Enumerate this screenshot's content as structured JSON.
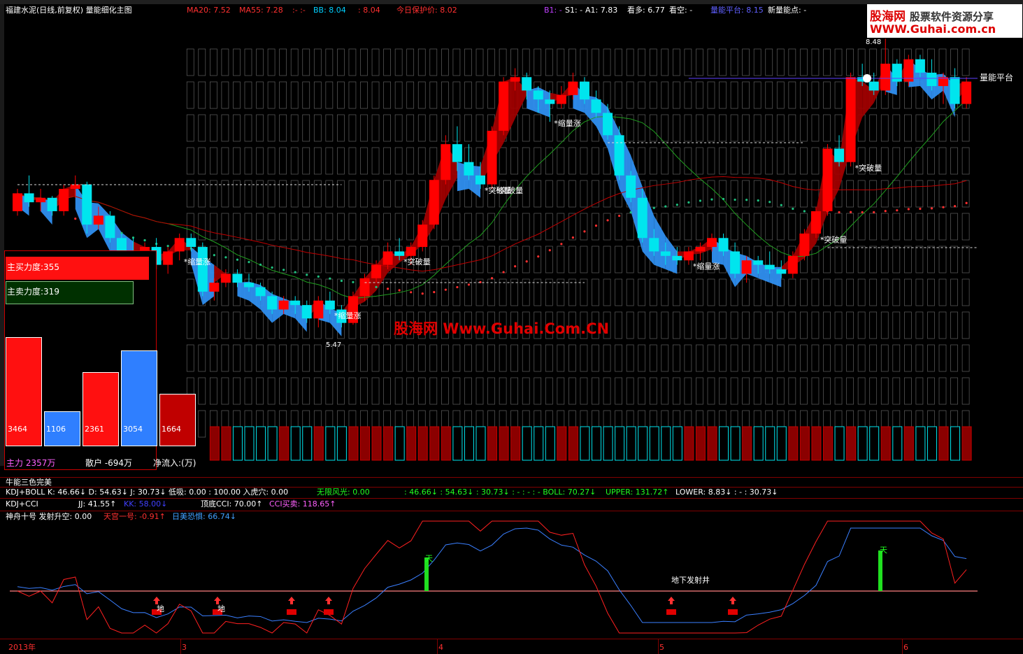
{
  "header": {
    "title": "福建水泥(日线,前复权) 量能细化主图",
    "ma20": "MA20: 7.52",
    "ma55": "MA55: 7.28",
    "dash1": ":- :-",
    "bb": "BB: 8.04",
    "bb2": ": 8.04",
    "protect": "今日保护价: 8.02",
    "b1": "B1: -",
    "s1": "S1: -",
    "a1": "A1: 7.83",
    "kanduo": "看多: 6.77",
    "kankong": "看空: -",
    "platform": "量能平台: 8.15",
    "newpoint": "新量能点: -"
  },
  "logo": {
    "line1": "股海网",
    "line1b": "股票软件资源分享",
    "line2": "WWW.Guhai.com.cn"
  },
  "watermark": "股海网 Www.Guhai.Com.CN",
  "colors": {
    "up": "#ff0000",
    "down": "#00e5ee",
    "blue_ribbon": "#2f8ff0",
    "red_ribbon": "#a00000",
    "ma_red": "#c00000",
    "ma_green": "#20a020",
    "grid": "#800000"
  },
  "chart_data": [
    {
      "type": "candlestick",
      "title": "量能细化主图",
      "price_marks": [
        "8.48",
        "5.47"
      ],
      "platform_label": "量能平台",
      "annotations": [
        {
          "text": "*缩量涨",
          "idx": 14
        },
        {
          "text": "*缩量涨",
          "idx": 27
        },
        {
          "text": "*突破量",
          "idx": 33
        },
        {
          "text": "*突破量",
          "idx": 40
        },
        {
          "text": "*突破量",
          "idx": 41
        },
        {
          "text": "*缩量涨",
          "idx": 46
        },
        {
          "text": "*缩量涨",
          "idx": 58
        },
        {
          "text": "*突破量",
          "idx": 69
        },
        {
          "text": "*突破量",
          "idx": 72
        }
      ],
      "ohlc": [
        [
          6.55,
          6.8,
          6.5,
          6.75
        ],
        [
          6.75,
          6.95,
          6.6,
          6.65
        ],
        [
          6.65,
          6.8,
          6.55,
          6.7
        ],
        [
          6.7,
          6.72,
          6.5,
          6.55
        ],
        [
          6.55,
          6.85,
          6.5,
          6.8
        ],
        [
          6.8,
          6.95,
          6.7,
          6.85
        ],
        [
          6.85,
          6.88,
          6.3,
          6.4
        ],
        [
          6.4,
          6.6,
          6.35,
          6.5
        ],
        [
          6.5,
          6.55,
          6.2,
          6.25
        ],
        [
          6.25,
          6.3,
          6.05,
          6.1
        ],
        [
          6.1,
          6.25,
          5.95,
          6.0
        ],
        [
          6.0,
          6.2,
          5.95,
          6.15
        ],
        [
          6.15,
          6.25,
          5.9,
          5.95
        ],
        [
          5.95,
          6.15,
          5.85,
          6.1
        ],
        [
          6.1,
          6.3,
          6.0,
          6.25
        ],
        [
          6.25,
          6.3,
          6.1,
          6.15
        ],
        [
          6.15,
          6.2,
          5.6,
          5.65
        ],
        [
          5.65,
          5.8,
          5.55,
          5.75
        ],
        [
          5.75,
          5.9,
          5.7,
          5.85
        ],
        [
          5.85,
          5.9,
          5.7,
          5.75
        ],
        [
          5.75,
          5.85,
          5.65,
          5.7
        ],
        [
          5.7,
          5.75,
          5.55,
          5.6
        ],
        [
          5.6,
          5.65,
          5.4,
          5.45
        ],
        [
          5.45,
          5.6,
          5.4,
          5.55
        ],
        [
          5.55,
          5.6,
          5.4,
          5.5
        ],
        [
          5.5,
          5.55,
          5.3,
          5.35
        ],
        [
          5.35,
          5.6,
          5.25,
          5.55
        ],
        [
          5.55,
          5.65,
          5.4,
          5.45
        ],
        [
          5.45,
          5.5,
          5.25,
          5.3
        ],
        [
          5.3,
          5.65,
          5.28,
          5.6
        ],
        [
          5.6,
          5.85,
          5.55,
          5.8
        ],
        [
          5.8,
          6.0,
          5.75,
          5.95
        ],
        [
          5.95,
          6.2,
          5.9,
          6.1
        ],
        [
          6.1,
          6.25,
          6.0,
          6.05
        ],
        [
          6.05,
          6.2,
          5.95,
          6.15
        ],
        [
          6.15,
          6.45,
          6.1,
          6.4
        ],
        [
          6.4,
          6.95,
          6.35,
          6.9
        ],
        [
          6.9,
          7.4,
          6.85,
          7.3
        ],
        [
          7.3,
          7.5,
          7.0,
          7.1
        ],
        [
          7.1,
          7.3,
          6.9,
          6.95
        ],
        [
          6.95,
          7.1,
          6.8,
          6.85
        ],
        [
          6.85,
          7.5,
          6.8,
          7.45
        ],
        [
          7.45,
          8.05,
          7.4,
          8.0
        ],
        [
          8.0,
          8.15,
          7.9,
          8.05
        ],
        [
          8.05,
          8.1,
          7.8,
          7.9
        ],
        [
          7.9,
          7.95,
          7.65,
          7.8
        ],
        [
          7.8,
          7.9,
          7.55,
          7.75
        ],
        [
          7.75,
          7.95,
          7.7,
          7.85
        ],
        [
          7.85,
          8.1,
          7.8,
          8.0
        ],
        [
          8.0,
          8.05,
          7.75,
          7.8
        ],
        [
          7.8,
          7.9,
          7.6,
          7.65
        ],
        [
          7.65,
          7.75,
          7.35,
          7.4
        ],
        [
          7.4,
          7.5,
          6.9,
          6.95
        ],
        [
          6.95,
          7.0,
          6.65,
          6.7
        ],
        [
          6.7,
          6.8,
          6.2,
          6.25
        ],
        [
          6.25,
          6.35,
          6.05,
          6.1
        ],
        [
          6.1,
          6.2,
          5.95,
          6.05
        ],
        [
          6.05,
          6.15,
          5.95,
          6.0
        ],
        [
          6.0,
          6.15,
          5.95,
          6.1
        ],
        [
          6.1,
          6.2,
          6.0,
          6.15
        ],
        [
          6.15,
          6.3,
          6.1,
          6.25
        ],
        [
          6.25,
          6.3,
          6.05,
          6.1
        ],
        [
          6.1,
          6.2,
          5.8,
          5.85
        ],
        [
          5.85,
          6.05,
          5.75,
          6.0
        ],
        [
          6.0,
          6.05,
          5.85,
          5.95
        ],
        [
          5.95,
          6.1,
          5.85,
          5.9
        ],
        [
          5.9,
          6.0,
          5.8,
          5.85
        ],
        [
          5.85,
          6.1,
          5.8,
          6.05
        ],
        [
          6.05,
          6.35,
          6.0,
          6.3
        ],
        [
          6.3,
          6.6,
          6.25,
          6.55
        ],
        [
          6.55,
          7.3,
          6.5,
          7.25
        ],
        [
          7.25,
          7.4,
          7.05,
          7.1
        ],
        [
          7.1,
          8.1,
          7.05,
          8.05
        ],
        [
          8.05,
          8.2,
          7.95,
          8.0
        ],
        [
          8.0,
          8.1,
          7.85,
          7.9
        ],
        [
          7.9,
          8.48,
          7.85,
          8.2
        ],
        [
          8.2,
          8.25,
          7.95,
          8.0
        ],
        [
          8.0,
          8.3,
          7.95,
          8.25
        ],
        [
          8.25,
          8.3,
          8.05,
          8.1
        ],
        [
          8.1,
          8.25,
          7.9,
          7.95
        ],
        [
          7.95,
          8.1,
          7.75,
          8.05
        ],
        [
          8.05,
          8.15,
          7.7,
          7.75
        ],
        [
          7.75,
          8.05,
          7.7,
          8.0
        ]
      ]
    },
    {
      "type": "bar",
      "title": "主力资金",
      "bars": [
        {
          "label": "主买力度:355"
        },
        {
          "label": "主卖力度:319"
        }
      ],
      "categories": [
        "3464",
        "1106",
        "2361",
        "3054",
        "1664"
      ],
      "values": [
        3464,
        1106,
        2361,
        3054,
        1664
      ],
      "footer": [
        "主力 2357万",
        "散户 -694万",
        "净流入:(万)"
      ]
    },
    {
      "type": "line",
      "title": "神舟十号",
      "indicator_rows": [
        {
          "text": "牛能三色完美"
        },
        {
          "text": "KDJ+BOLL  K: 46.66↓  D: 54.63↓  J: 30.73↓  低吸: 0.00  : 100.00  入虎穴: 0.00"
        },
        {
          "text": "无限风光: 0.00"
        },
        {
          "text": ": 46.66↓  : 54.63↓  : 30.73↓  : - : - : -  BOLL: 70.27↓"
        },
        {
          "text": "UPPER: 131.72↑"
        },
        {
          "text": "LOWER: 8.83↓   : - : 30.73↓"
        },
        {
          "text": "KDJ+CCI"
        },
        {
          "text": "JJ: 41.55↑"
        },
        {
          "text": "KK: 58.00↓"
        },
        {
          "text": "顶底CCI: 70.00↑"
        },
        {
          "text": "CCI买卖: 118.65↑"
        },
        {
          "text": "神舟十号  发射升空: 0.00"
        },
        {
          "text": "天宫一号: -0.91↑"
        },
        {
          "text": "日美恐惧: 66.74↓"
        }
      ],
      "signals": [
        "天",
        "天",
        "地",
        "地",
        "地下发射井"
      ],
      "x_labels": [
        "2013年",
        "3",
        "4",
        "5",
        "6"
      ]
    }
  ]
}
